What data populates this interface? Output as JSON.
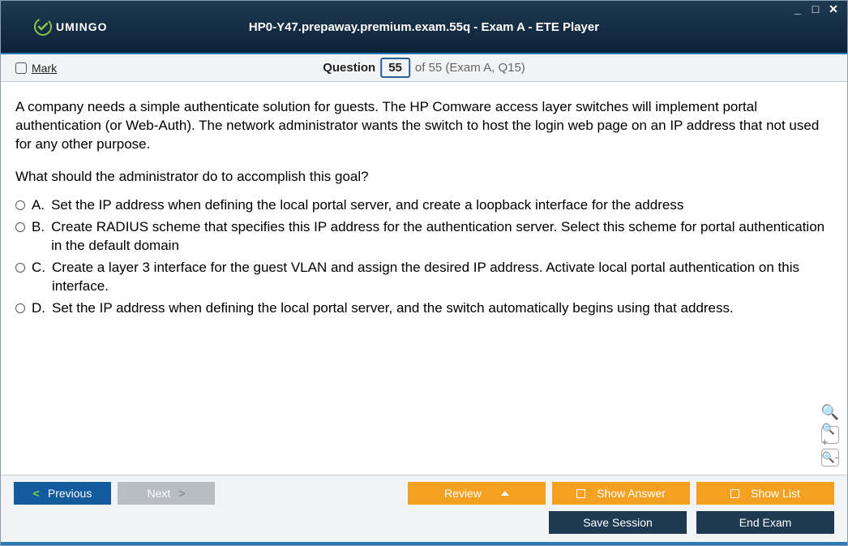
{
  "window": {
    "title": "HP0-Y47.prepaway.premium.exam.55q - Exam A - ETE Player",
    "logo_text": "UMINGO"
  },
  "toolbar": {
    "mark_label": "Mark",
    "question_label": "Question",
    "current": "55",
    "of_label": "of 55 (Exam A, Q15)"
  },
  "question": {
    "stem": "A company needs a simple authenticate solution for guests. The HP Comware access layer switches will implement portal authentication (or Web-Auth). The network administrator wants the switch to host the login web page on an IP address that not used for any other purpose.",
    "prompt": "What should the administrator do to accomplish this goal?",
    "options": [
      {
        "letter": "A.",
        "text": "Set the IP address when defining the local portal server, and create a loopback interface for the address"
      },
      {
        "letter": "B.",
        "text": "Create RADIUS scheme that specifies this IP address for the authentication server. Select this scheme for portal authentication in the default domain"
      },
      {
        "letter": "C.",
        "text": "Create a layer 3 interface for the guest VLAN and assign the desired IP address. Activate local portal authentication on this interface."
      },
      {
        "letter": "D.",
        "text": "Set the IP address when defining the local portal server, and the switch automatically begins using that address."
      }
    ]
  },
  "footer": {
    "previous": "Previous",
    "next": "Next",
    "review": "Review",
    "show_answer": "Show Answer",
    "show_list": "Show List",
    "save_session": "Save Session",
    "end_exam": "End Exam"
  }
}
